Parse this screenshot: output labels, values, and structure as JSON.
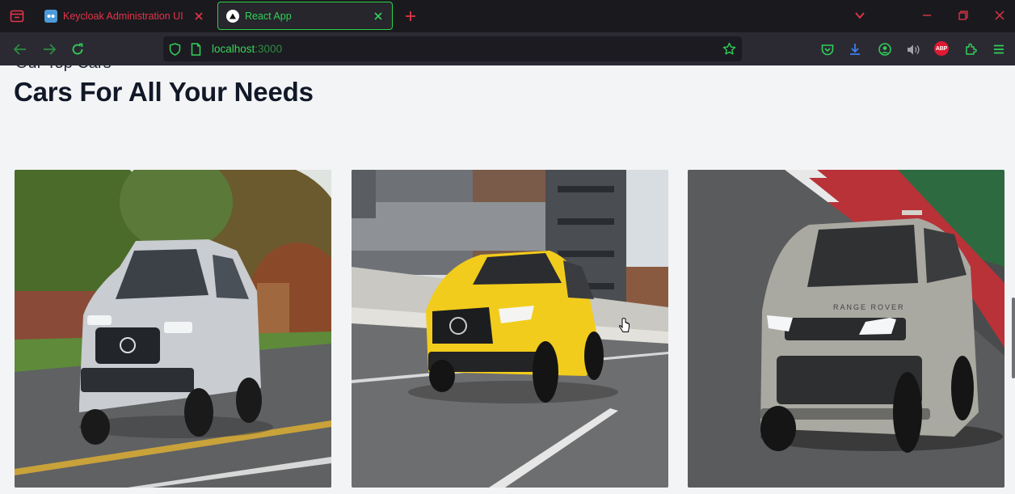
{
  "browser": {
    "tabs": [
      {
        "title": "Keycloak Administration UI",
        "active": false,
        "favicon": "keycloak-icon"
      },
      {
        "title": "React App",
        "active": true,
        "favicon": "react-app-icon"
      }
    ],
    "url": {
      "host": "localhost",
      "port": ":3000"
    },
    "accent_color": "#30d158",
    "inactive_tab_color": "#e4344a",
    "toolbar_icons": [
      "pocket-icon",
      "download-icon",
      "account-icon",
      "volume-icon",
      "adblock-plus-icon",
      "extensions-icon",
      "menu-icon"
    ],
    "adblock_label": "ABP"
  },
  "page": {
    "subtitle": "Our Top Cars",
    "heading": "Cars For All Your Needs",
    "cars": [
      {
        "alt": "Silver Mercedes-Benz SUV",
        "color": "#c9ccd0"
      },
      {
        "alt": "Yellow Mercedes-Benz hatchback",
        "color": "#f2cc1c"
      },
      {
        "alt": "Grey Range Rover SUV",
        "color": "#a9a9a1"
      }
    ]
  }
}
